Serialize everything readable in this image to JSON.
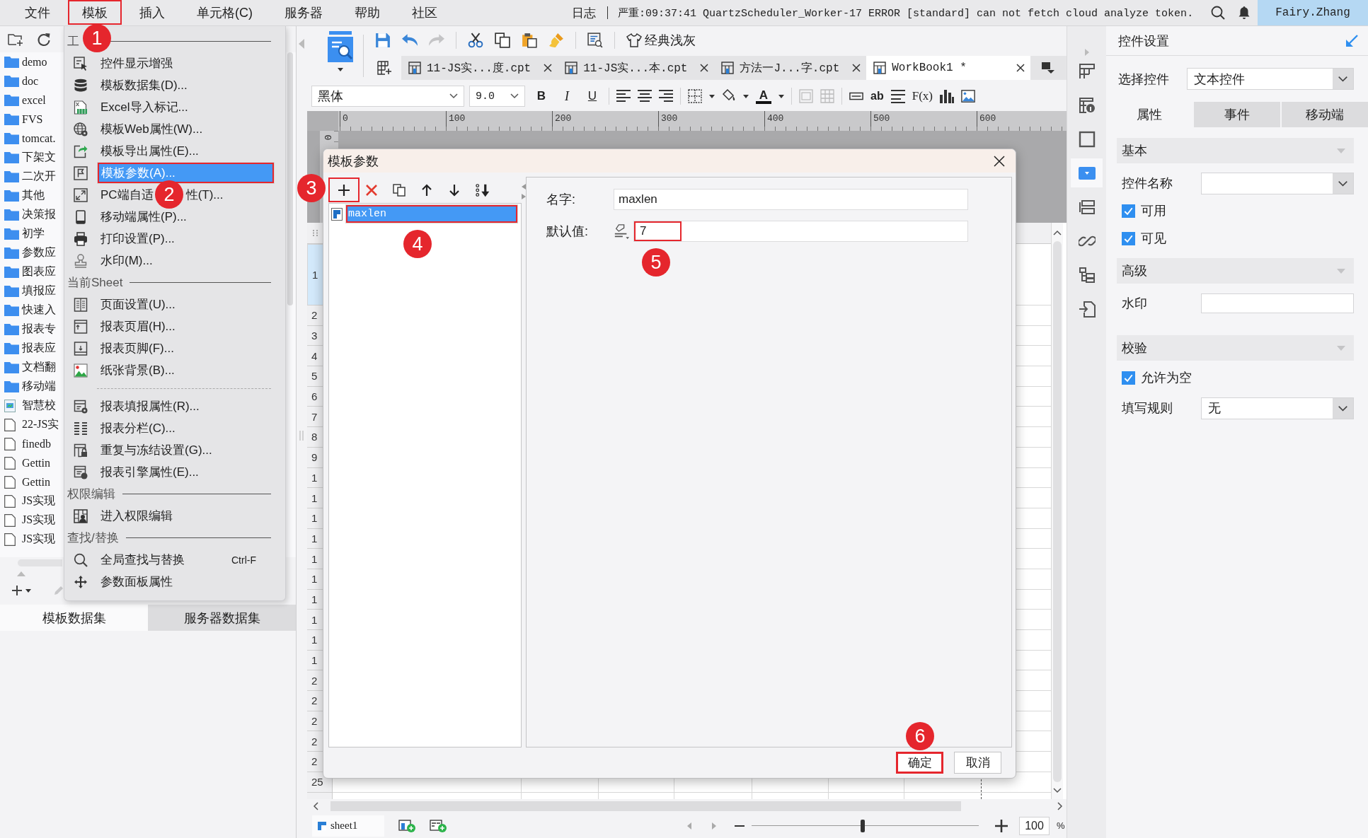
{
  "menu_bar": {
    "items": [
      {
        "label": "文件"
      },
      {
        "label": "模板",
        "step": "1"
      },
      {
        "label": "插入"
      },
      {
        "label": "单元格(C)"
      },
      {
        "label": "服务器"
      },
      {
        "label": "帮助"
      },
      {
        "label": "社区"
      }
    ],
    "log_label": "日志",
    "log_message": "严重:09:37:41 QuartzScheduler_Worker-17 ERROR [standard] can not fetch cloud analyze token.",
    "user": "Fairy.Zhang"
  },
  "file_tree": {
    "items": [
      {
        "kind": "folder",
        "label": "demo"
      },
      {
        "kind": "folder",
        "label": "doc"
      },
      {
        "kind": "folder",
        "label": "excel"
      },
      {
        "kind": "folder",
        "label": "FVS"
      },
      {
        "kind": "folder",
        "label": "tomcat."
      },
      {
        "kind": "folder",
        "label": "下架文"
      },
      {
        "kind": "folder",
        "label": "二次开"
      },
      {
        "kind": "folder",
        "label": "其他"
      },
      {
        "kind": "folder",
        "label": "决策报"
      },
      {
        "kind": "folder",
        "label": "初学"
      },
      {
        "kind": "folder",
        "label": "参数应"
      },
      {
        "kind": "folder",
        "label": "图表应"
      },
      {
        "kind": "folder",
        "label": "填报应"
      },
      {
        "kind": "folder",
        "label": "快速入"
      },
      {
        "kind": "folder",
        "label": "报表专"
      },
      {
        "kind": "folder",
        "label": "报表应"
      },
      {
        "kind": "folder",
        "label": "文档翻"
      },
      {
        "kind": "folder",
        "label": "移动端"
      },
      {
        "kind": "app",
        "label": "智慧校"
      },
      {
        "kind": "file",
        "label": "22-JS实"
      },
      {
        "kind": "file",
        "label": "finedb"
      },
      {
        "kind": "file",
        "label": "Gettin"
      },
      {
        "kind": "file",
        "label": "Gettin"
      },
      {
        "kind": "file",
        "label": "JS实现"
      },
      {
        "kind": "file",
        "label": "JS实现"
      },
      {
        "kind": "file",
        "label": "JS实现"
      }
    ]
  },
  "dataset_tabs": [
    {
      "label": "模板数据集",
      "selected": true
    },
    {
      "label": "服务器数据集",
      "selected": false
    }
  ],
  "template_menu": {
    "entries": [
      {
        "kind": "header",
        "label": "工"
      },
      {
        "kind": "item",
        "label": "控件显示增强",
        "selected": false
      },
      {
        "kind": "item",
        "label": "模板数据集(D)...",
        "selected": false
      },
      {
        "kind": "item",
        "label": "Excel导入标记...",
        "selected": false
      },
      {
        "kind": "item",
        "label": "模板Web属性(W)...",
        "selected": false
      },
      {
        "kind": "item",
        "label": "模板导出属性(E)...",
        "selected": false
      },
      {
        "kind": "item",
        "label": "模板参数(A)...",
        "selected": true,
        "step": "2"
      },
      {
        "kind": "item",
        "label_parts": [
          "PC端自适",
          "性(T)..."
        ],
        "selected": false
      },
      {
        "kind": "item",
        "label": "移动端属性(P)...",
        "selected": false
      },
      {
        "kind": "item",
        "label": "打印设置(P)...",
        "selected": false
      },
      {
        "kind": "item",
        "label": "水印(M)...",
        "selected": false
      },
      {
        "kind": "header",
        "label": "当前Sheet"
      },
      {
        "kind": "item",
        "label": "页面设置(U)...",
        "selected": false
      },
      {
        "kind": "item",
        "label": "报表页眉(H)...",
        "selected": false
      },
      {
        "kind": "item",
        "label": "报表页脚(F)...",
        "selected": false
      },
      {
        "kind": "item",
        "label": "纸张背景(B)...",
        "selected": false
      },
      {
        "kind": "separator"
      },
      {
        "kind": "item",
        "label": "报表填报属性(R)...",
        "selected": false
      },
      {
        "kind": "item",
        "label": "报表分栏(C)...",
        "selected": false
      },
      {
        "kind": "item",
        "label": "重复与冻结设置(G)...",
        "selected": false
      },
      {
        "kind": "item",
        "label": "报表引擎属性(E)...",
        "selected": false
      },
      {
        "kind": "header",
        "label": "权限编辑"
      },
      {
        "kind": "item",
        "label": "进入权限编辑",
        "selected": false
      },
      {
        "kind": "header",
        "label": "查找/替换"
      },
      {
        "kind": "item",
        "label": "全局查找与替换",
        "shortcut": "Ctrl-F",
        "selected": false
      },
      {
        "kind": "item",
        "label": "参数面板属性",
        "selected": false
      }
    ]
  },
  "quick_toolbar": {
    "theme_label": "经典浅灰"
  },
  "doc_tabs": [
    {
      "label": "11-JS实...度.cpt",
      "selected": false
    },
    {
      "label": "11-JS实...本.cpt",
      "selected": false
    },
    {
      "label": "方法一J...字.cpt",
      "selected": false
    },
    {
      "label": "WorkBook1 *",
      "selected": true
    }
  ],
  "format_bar": {
    "font": "黑体",
    "size": "9.0",
    "style_glyphs": [
      "B",
      "I",
      "U"
    ],
    "color_glyph": "A",
    "insert_glyphs": [
      "ab",
      "F(x)"
    ]
  },
  "ruler": {
    "labels": [
      "0",
      "100",
      "200",
      "300",
      "400",
      "500",
      "600"
    ],
    "vertical_label": "0"
  },
  "sheet": {
    "rows": [
      {
        "label": "1",
        "selected": true
      },
      {
        "label": "2",
        "selected": false
      },
      {
        "label": "3",
        "selected": false
      },
      {
        "label": "4",
        "selected": false
      },
      {
        "label": "5",
        "selected": false
      },
      {
        "label": "6",
        "selected": false
      },
      {
        "label": "7",
        "selected": false
      },
      {
        "label": "8",
        "selected": false
      },
      {
        "label": "9",
        "selected": false
      },
      {
        "label": "1",
        "selected": false
      },
      {
        "label": "1",
        "selected": false
      },
      {
        "label": "1",
        "selected": false
      },
      {
        "label": "1",
        "selected": false
      },
      {
        "label": "1",
        "selected": false
      },
      {
        "label": "1",
        "selected": false
      },
      {
        "label": "1",
        "selected": false
      },
      {
        "label": "1",
        "selected": false
      },
      {
        "label": "1",
        "selected": false
      },
      {
        "label": "1",
        "selected": false
      },
      {
        "label": "2",
        "selected": false
      },
      {
        "label": "2",
        "selected": false
      },
      {
        "label": "2",
        "selected": false
      },
      {
        "label": "2",
        "selected": false
      },
      {
        "label": "2",
        "selected": false
      },
      {
        "label": "25",
        "selected": false
      }
    ],
    "sheet_tabs": [
      {
        "label": "sheet1",
        "selected": true
      }
    ],
    "zoom": {
      "level": 0.49,
      "value": "100",
      "unit": "%"
    }
  },
  "dialog": {
    "title": "模板参数",
    "add_step": "3",
    "parameters": [
      {
        "name": "maxlen",
        "selected": true,
        "step": "4"
      }
    ],
    "name_label": "名字:",
    "name_value": "maxlen",
    "default_label": "默认值:",
    "default_value": "7",
    "default_step": "5",
    "buttons": [
      {
        "label": "确定",
        "step": "6"
      },
      {
        "label": "取消"
      }
    ]
  },
  "side_tools": [
    {
      "selected": false
    },
    {
      "selected": false
    },
    {
      "selected": false
    },
    {
      "selected": true
    },
    {
      "selected": false
    },
    {
      "selected": false
    },
    {
      "selected": false
    },
    {
      "selected": false
    }
  ],
  "widget_panel": {
    "title": "控件设置",
    "select_label": "选择控件",
    "select_value": "文本控件",
    "tabs": [
      {
        "label": "属性",
        "selected": true
      },
      {
        "label": "事件",
        "selected": false
      },
      {
        "label": "移动端",
        "selected": false
      }
    ],
    "sections": [
      {
        "title": "基本",
        "expanded": true,
        "rows": [
          {
            "kind": "combo",
            "label": "控件名称"
          },
          {
            "kind": "checkbox",
            "label": "可用",
            "checked": true
          },
          {
            "kind": "checkbox",
            "label": "可见",
            "checked": true
          }
        ]
      },
      {
        "title": "高级",
        "expanded": true,
        "rows": [
          {
            "kind": "text",
            "label": "水印"
          }
        ]
      },
      {
        "title": "校验",
        "expanded": true,
        "rows": [
          {
            "kind": "checkbox",
            "label": "允许为空",
            "checked": true
          },
          {
            "kind": "combo",
            "label": "填写规则",
            "value": "无"
          }
        ]
      }
    ]
  }
}
